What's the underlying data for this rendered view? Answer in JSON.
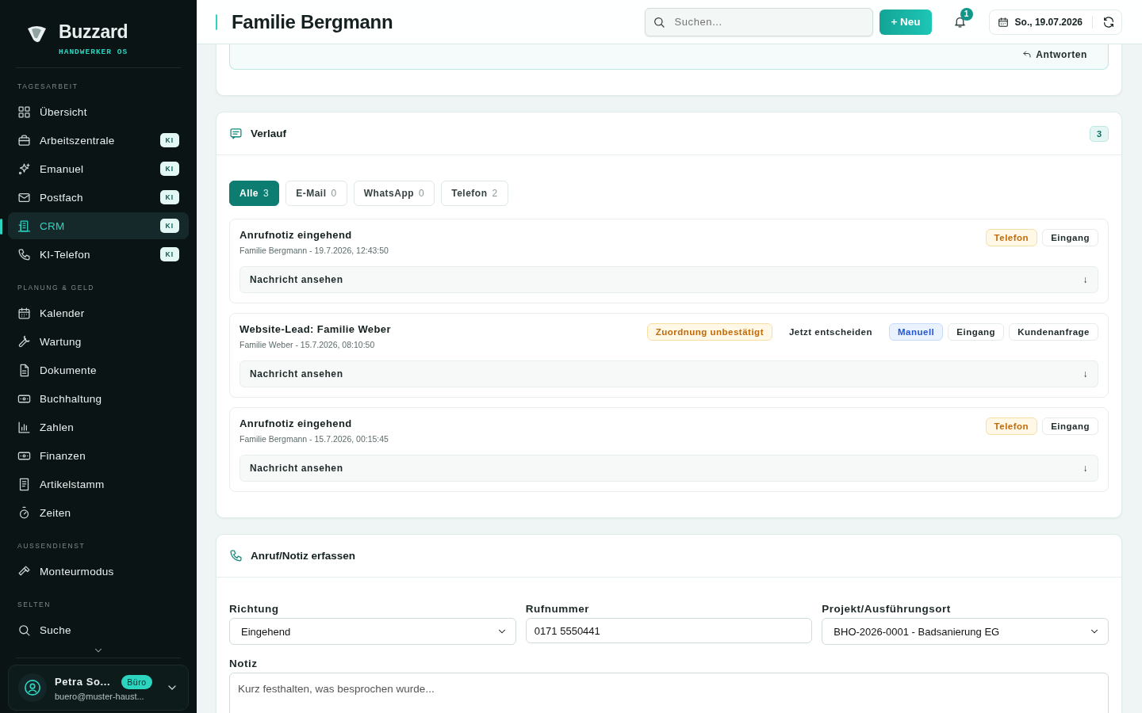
{
  "brand": {
    "name": "Buzzard",
    "tagline": "HANDWERKER OS"
  },
  "sidebar": {
    "sections": [
      {
        "title": "TAGESARBEIT",
        "items": [
          {
            "label": "Übersicht",
            "selected": false
          },
          {
            "label": "Arbeitszentrale",
            "badge": "KI",
            "selected": false
          },
          {
            "label": "Emanuel",
            "badge": "KI",
            "selected": false
          },
          {
            "label": "Postfach",
            "badge": "KI",
            "selected": false
          },
          {
            "label": "CRM",
            "badge": "KI",
            "selected": true
          },
          {
            "label": "KI-Telefon",
            "badge": "KI",
            "selected": false
          }
        ]
      },
      {
        "title": "PLANUNG & GELD",
        "items": [
          {
            "label": "Kalender",
            "selected": false
          },
          {
            "label": "Wartung",
            "selected": false
          },
          {
            "label": "Dokumente",
            "selected": false
          },
          {
            "label": "Buchhaltung",
            "selected": false
          },
          {
            "label": "Zahlen",
            "selected": false
          },
          {
            "label": "Finanzen",
            "selected": false
          },
          {
            "label": "Artikelstamm",
            "selected": false
          },
          {
            "label": "Zeiten",
            "selected": false
          }
        ]
      },
      {
        "title": "AUSSENDIENST",
        "items": [
          {
            "label": "Monteurmodus",
            "selected": false
          }
        ]
      },
      {
        "title": "SELTEN",
        "items": [
          {
            "label": "Suche",
            "selected": false
          }
        ]
      }
    ],
    "user": {
      "name": "Petra So...",
      "role": "Büro",
      "email": "buero@muster-haust..."
    }
  },
  "header": {
    "title": "Familie Bergmann",
    "search": {
      "placeholder": "Suchen..."
    },
    "new_button": "+ Neu",
    "notifications": "1",
    "date": "So., 19.07.2026"
  },
  "reply_card": {
    "button": "Antworten"
  },
  "history": {
    "title": "Verlauf",
    "count": "3",
    "filters": [
      {
        "label": "Alle",
        "count": "3",
        "selected": true
      },
      {
        "label": "E-Mail",
        "count": "0",
        "selected": false
      },
      {
        "label": "WhatsApp",
        "count": "0",
        "selected": false
      },
      {
        "label": "Telefon",
        "count": "2",
        "selected": false
      }
    ],
    "entries": [
      {
        "title": "Anrufnotiz eingehend",
        "meta": "Familie Bergmann - 19.7.2026, 12:43:50",
        "tags": [
          {
            "label": "Telefon",
            "kind": "warning"
          },
          {
            "label": "Eingang",
            "kind": "plain"
          }
        ],
        "toggle": "Nachricht ansehen",
        "arrow": "↓"
      },
      {
        "title": "Website-Lead: Familie Weber",
        "meta": "Familie Weber - 15.7.2026, 08:10:50",
        "tags": [
          {
            "label": "Zuordnung unbestätigt",
            "kind": "warning"
          },
          {
            "label": "Jetzt entscheiden",
            "kind": "action"
          },
          {
            "label": "Manuell",
            "kind": "info"
          },
          {
            "label": "Eingang",
            "kind": "plain"
          },
          {
            "label": "Kundenanfrage",
            "kind": "plain"
          }
        ],
        "toggle": "Nachricht ansehen",
        "arrow": "↓"
      },
      {
        "title": "Anrufnotiz eingehend",
        "meta": "Familie Bergmann - 15.7.2026, 00:15:45",
        "tags": [
          {
            "label": "Telefon",
            "kind": "warning"
          },
          {
            "label": "Eingang",
            "kind": "plain"
          }
        ],
        "toggle": "Nachricht ansehen",
        "arrow": "↓"
      }
    ]
  },
  "note_form": {
    "title": "Anruf/Notiz erfassen",
    "fields": [
      {
        "label": "Richtung",
        "kind": "select",
        "value": "Eingehend"
      },
      {
        "label": "Rufnummer",
        "kind": "input",
        "value": "0171 5550441"
      },
      {
        "label": "Projekt/Ausführungsort",
        "kind": "select",
        "value": "BHO-2026-0001 - Badsanierung EG"
      },
      {
        "label": "Notiz",
        "kind": "textarea",
        "placeholder": "Kurz festhalten, was besprochen wurde..."
      }
    ]
  }
}
